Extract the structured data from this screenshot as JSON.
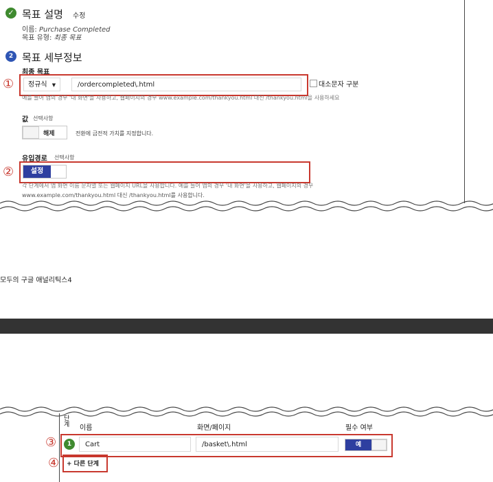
{
  "section1": {
    "title": "목표 설명",
    "edit_label": "수정",
    "name_label": "이름:",
    "name_value": "Purchase Completed",
    "type_label": "목표 유형:",
    "type_value": "최종 목표"
  },
  "section2": {
    "step_number": "2",
    "title": "목표 세부정보",
    "final_goal_label": "최종 목표",
    "match_type": "정규식",
    "url_value": "/ordercompleted\\.html",
    "case_sensitive_label": "대소문자 구분",
    "hint": "예를 들어 앱의 경우 '내 화면'을 사용하고, 웹페이지의 경우 www.example.com/thankyou.html 대신 /thankyou.html을 사용하세요",
    "value_label": "값",
    "value_optional": "선택사항",
    "value_toggle": "해제",
    "value_desc": "전환에 금전적 가치를 지정합니다.",
    "funnel_label": "유입경로",
    "funnel_optional": "선택사항",
    "funnel_toggle": "설정",
    "funnel_desc_1": "각 단계에서 앱 화면 이름 문자열 또는 웹페이지 URL을 사용합니다. 예를 들어 앱의 경우 '내 화면'을 사용하고, 웹페이지의 경우",
    "funnel_desc_2": "www.example.com/thankyou.html 대신 /thankyou.html를 사용합니다."
  },
  "annotations": {
    "a1": "①",
    "a2": "②",
    "a3": "③",
    "a4": "④"
  },
  "book_footer": "모두의 구글 애널리틱스4",
  "funnel_table": {
    "col_step": "단계",
    "col_name": "이름",
    "col_screen": "화면/페이지",
    "col_required": "필수 여부",
    "row_step": "1",
    "row_name": "Cart",
    "row_screen": "/basket\\.html",
    "row_required": "예",
    "add_step": "+ 다른 단계"
  }
}
